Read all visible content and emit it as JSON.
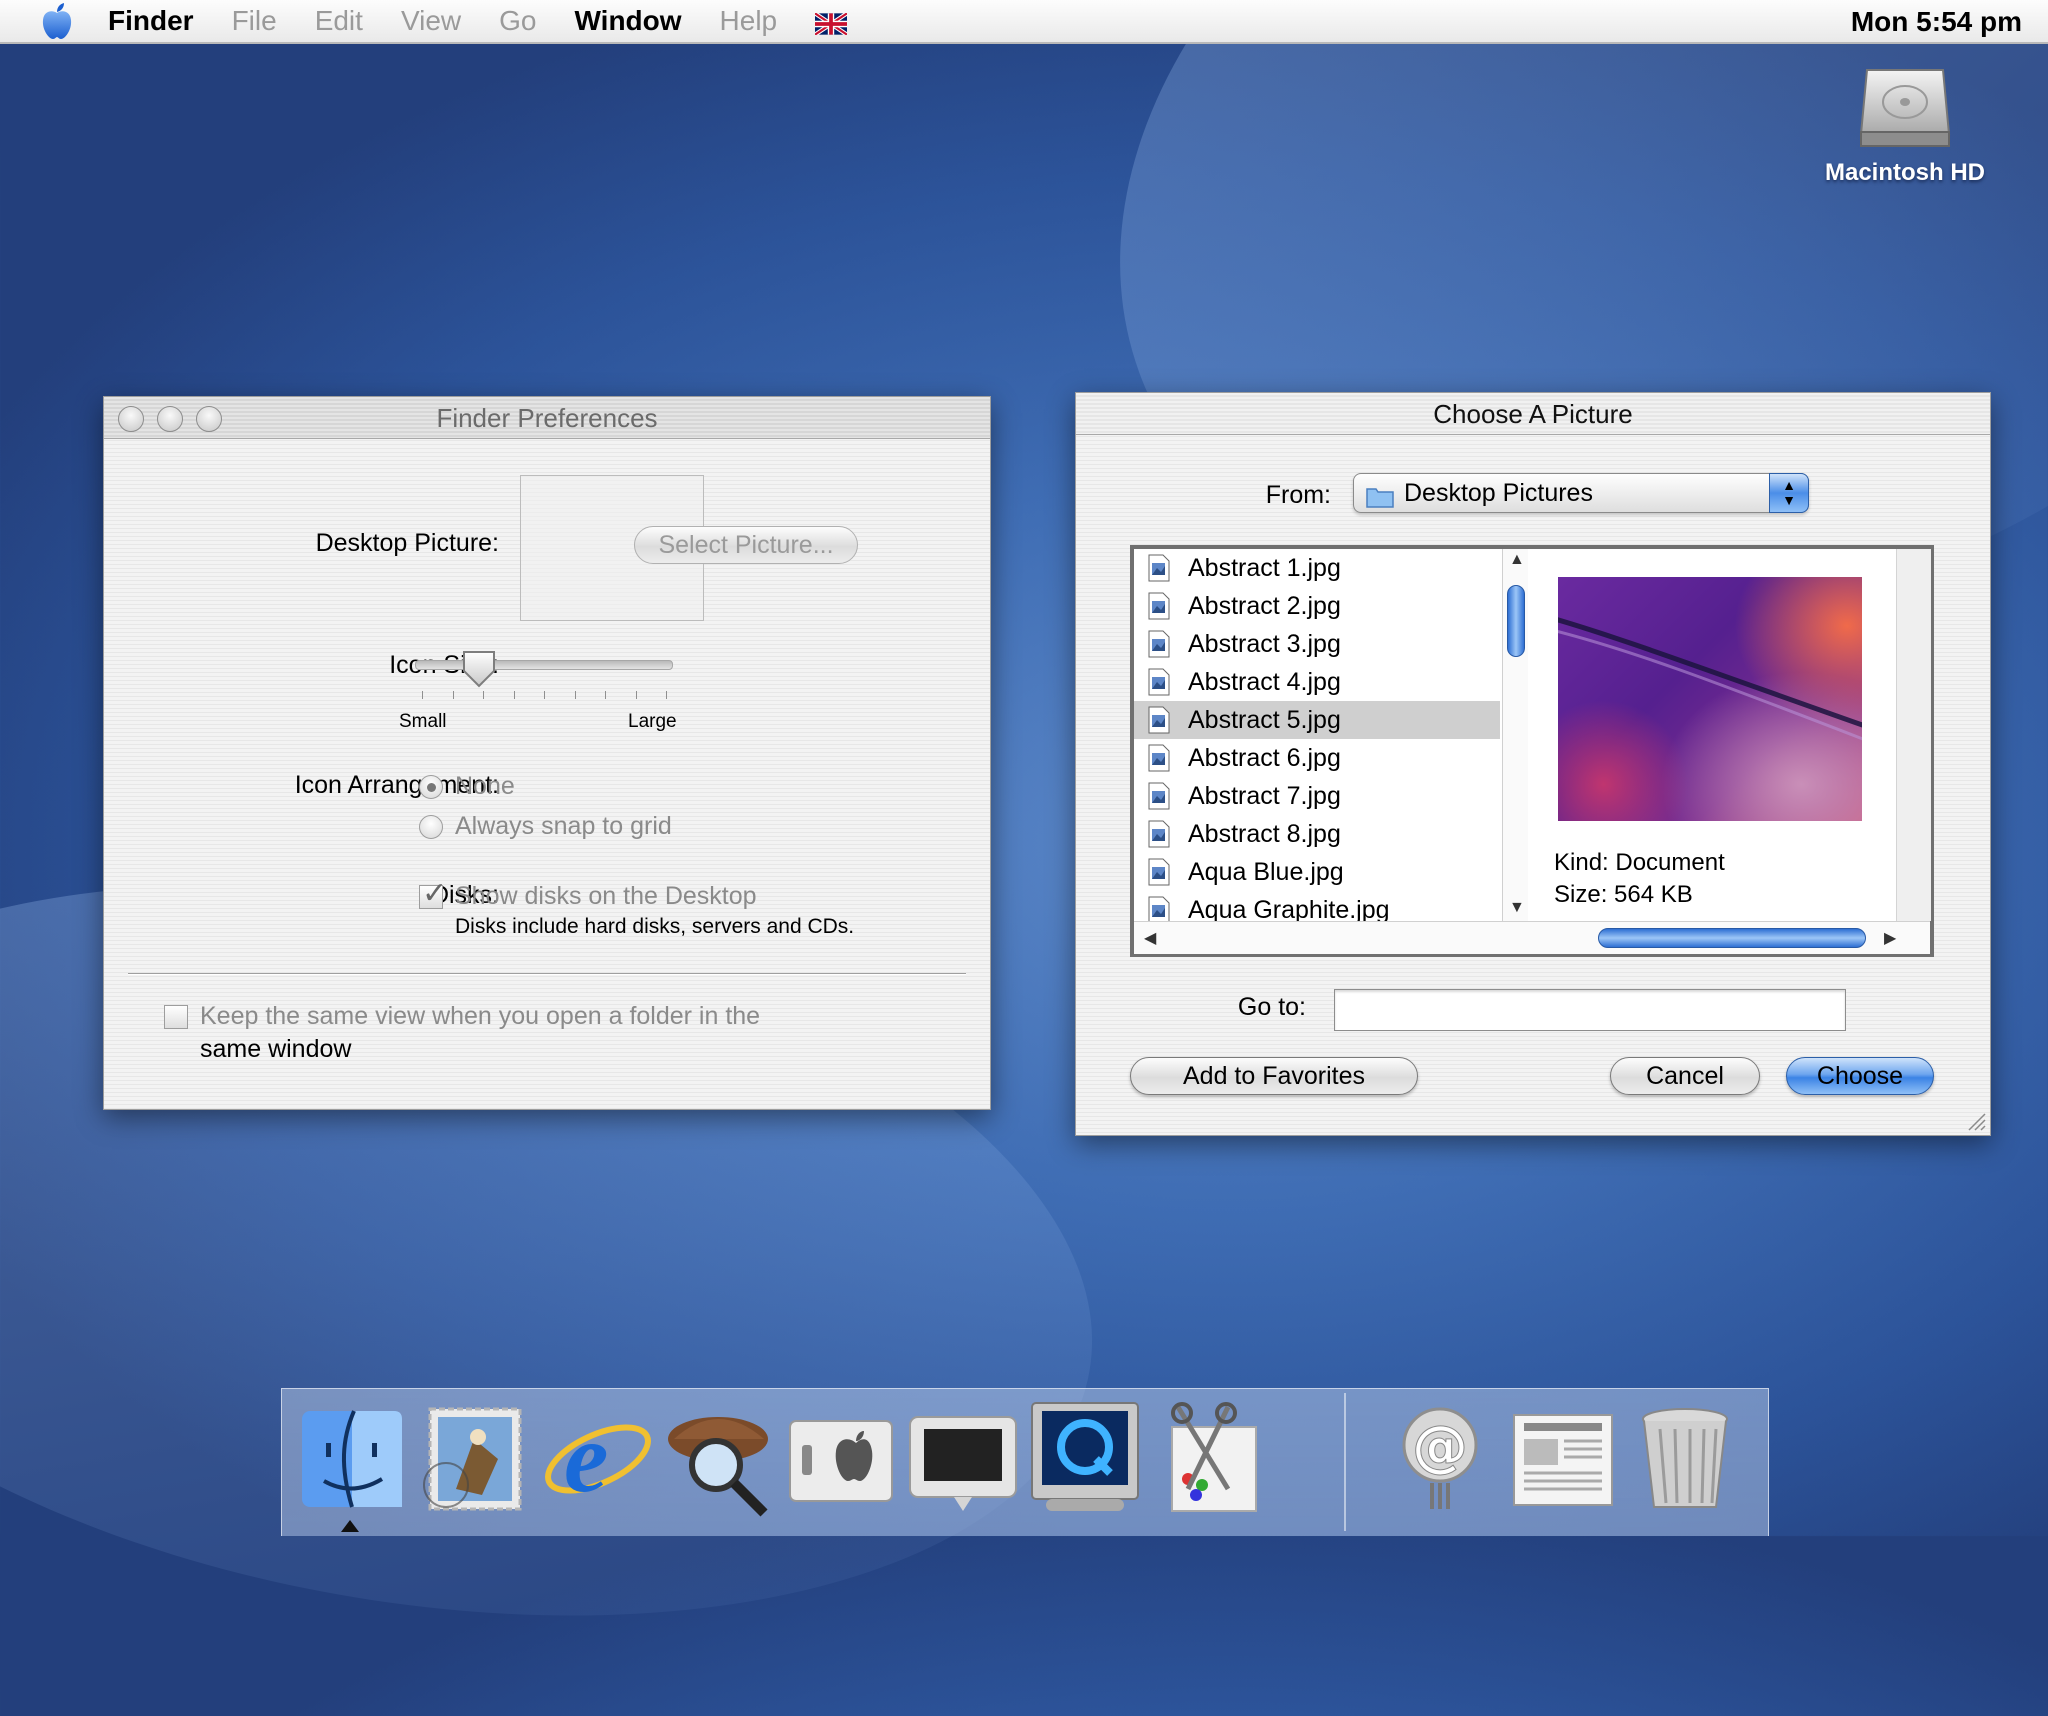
{
  "menubar": {
    "app_name": "Finder",
    "items": [
      {
        "label": "File",
        "enabled": false
      },
      {
        "label": "Edit",
        "enabled": false
      },
      {
        "label": "View",
        "enabled": false
      },
      {
        "label": "Go",
        "enabled": false
      },
      {
        "label": "Window",
        "enabled": true
      },
      {
        "label": "Help",
        "enabled": false
      }
    ],
    "input_icon": "uk-flag-icon",
    "clock": "Mon 5:54 pm"
  },
  "desktop": {
    "disk_label": "Macintosh HD",
    "disk_icon": "hard-disk-icon"
  },
  "finder_prefs": {
    "title": "Finder Preferences",
    "desktop_picture_label": "Desktop Picture:",
    "select_picture_button": "Select Picture...",
    "icon_size_label": "Icon Size:",
    "icon_size_small": "Small",
    "icon_size_large": "Large",
    "icon_size_value": 0.25,
    "icon_arrangement_label": "Icon Arrangement:",
    "arrangement_none": "None",
    "arrangement_snap": "Always snap to grid",
    "arrangement_selected": "None",
    "disks_label": "Disks:",
    "show_disks": "Show disks on the Desktop",
    "show_disks_checked": true,
    "disks_note": "Disks include hard disks, servers and CDs.",
    "same_view_line1": "Keep the same view when you open a folder in the",
    "same_view_line2": "same window",
    "same_view_checked": false
  },
  "choose_picture": {
    "title": "Choose A Picture",
    "from_label": "From:",
    "from_value": "Desktop Pictures",
    "files": [
      "Abstract 1.jpg",
      "Abstract 2.jpg",
      "Abstract 3.jpg",
      "Abstract 4.jpg",
      "Abstract 5.jpg",
      "Abstract 6.jpg",
      "Abstract 7.jpg",
      "Abstract 8.jpg",
      "Aqua Blue.jpg",
      "Aqua Graphite.jpg"
    ],
    "selected_file": "Abstract 5.jpg",
    "preview_kind": "Kind: Document",
    "preview_size": "Size: 564 KB",
    "goto_label": "Go to:",
    "goto_value": "",
    "add_favorites_button": "Add to Favorites",
    "cancel_button": "Cancel",
    "choose_button": "Choose"
  },
  "dock": {
    "items": [
      {
        "name": "Finder",
        "icon": "finder-icon"
      },
      {
        "name": "Mail",
        "icon": "mail-stamp-icon"
      },
      {
        "name": "Internet Explorer",
        "icon": "internet-explorer-icon"
      },
      {
        "name": "Sherlock",
        "icon": "sherlock-icon"
      },
      {
        "name": "System Preferences",
        "icon": "system-preferences-icon"
      },
      {
        "name": "Display",
        "icon": "monitor-icon"
      },
      {
        "name": "QuickTime Player",
        "icon": "quicktime-icon"
      },
      {
        "name": "Image Editor",
        "icon": "scissors-icon"
      },
      {
        "name": "Internet Connect",
        "icon": "at-sign-icon"
      },
      {
        "name": "Documents",
        "icon": "newspaper-icon"
      },
      {
        "name": "Trash",
        "icon": "trash-icon"
      }
    ]
  }
}
